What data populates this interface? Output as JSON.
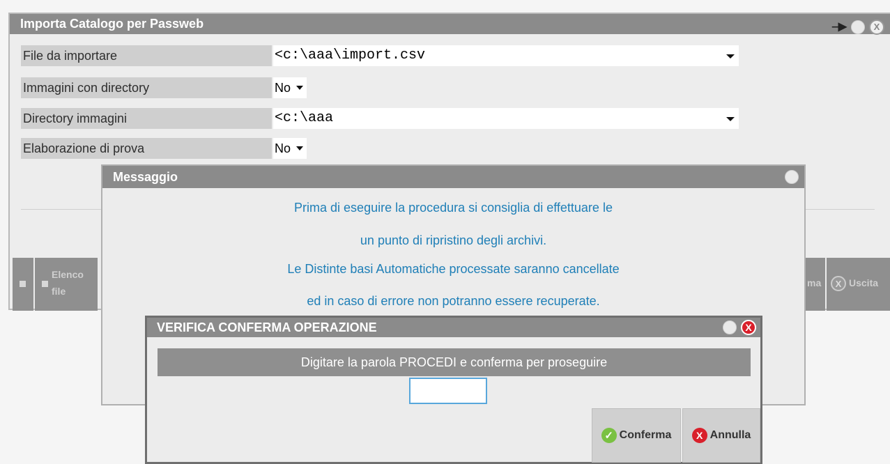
{
  "main": {
    "title": "Importa Catalogo per Passweb",
    "fields": [
      {
        "label": "File da importare",
        "value": "<c:\\aaa\\import.csv"
      },
      {
        "label": "Immagini con directory",
        "value": "No"
      },
      {
        "label": "Directory immagini",
        "value": "<c:\\aaa"
      },
      {
        "label": "Elaborazione di prova",
        "value": "No"
      }
    ],
    "buttons": {
      "elenco_line1": "Elenco",
      "elenco_line2": "file",
      "conferma_partial": "ma",
      "uscita_partial": "Uscita"
    }
  },
  "message": {
    "title": "Messaggio",
    "lines": [
      "Prima di eseguire la procedura si consiglia di effettuare le",
      "un punto di ripristino degli archivi.",
      "Le Distinte basi Automatiche processate saranno cancellate",
      "ed in caso di errore non potranno essere recuperate."
    ]
  },
  "verify": {
    "title": "VERIFICA CONFERMA OPERAZIONE",
    "instruction": "Digitare la parola PROCEDI e conferma per proseguire",
    "input_value": "",
    "confirm_label": "Conferma",
    "cancel_label": "Annulla"
  },
  "icons": {
    "pin": "pin-icon",
    "circle": "circle-icon",
    "close": "close-icon",
    "check": "check-icon"
  }
}
